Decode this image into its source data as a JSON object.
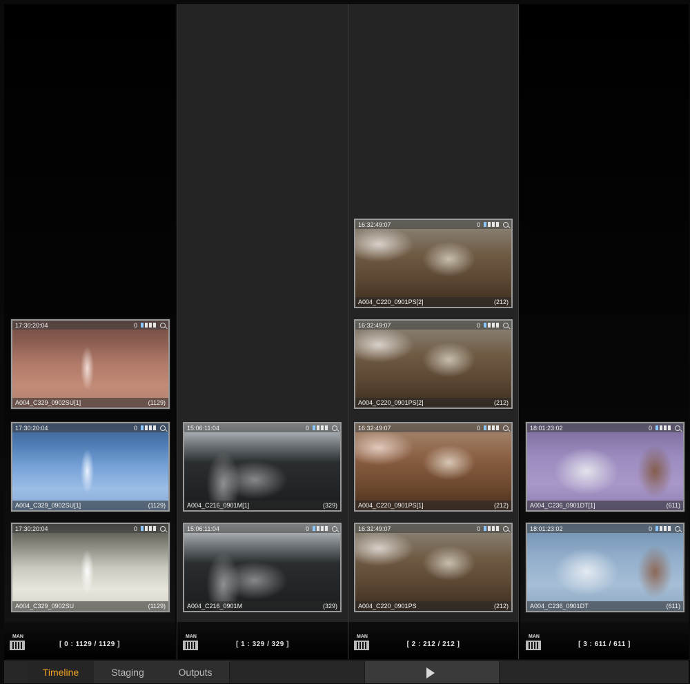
{
  "columns": [
    {
      "clips": [
        {
          "tc": "17:30:20:04",
          "name": "A004_C329_0902SU[1]",
          "frames": "(1129)"
        },
        {
          "tc": "17:30:20:04",
          "name": "A004_C329_0902SU[1]",
          "frames": "(1129)"
        },
        {
          "tc": "17:30:20:04",
          "name": "A004_C329_0902SU",
          "frames": "(1129)"
        }
      ],
      "badge": "MAN",
      "count": "[ 0 : 1129 / 1129 ]"
    },
    {
      "clips": [
        {
          "tc": "15:06:11:04",
          "name": "A004_C216_0901M[1]",
          "frames": "(329)"
        },
        {
          "tc": "15:06:11:04",
          "name": "A004_C216_0901M",
          "frames": "(329)"
        }
      ],
      "badge": "MAN",
      "count": "[ 1 : 329 / 329 ]"
    },
    {
      "clips": [
        {
          "tc": "16:32:49:07",
          "name": "A004_C220_0901PS[2]",
          "frames": "(212)"
        },
        {
          "tc": "16:32:49:07",
          "name": "A004_C220_0901PS[2]",
          "frames": "(212)"
        },
        {
          "tc": "16:32:49:07",
          "name": "A004_C220_0901PS[1]",
          "frames": "(212)"
        },
        {
          "tc": "16:32:49:07",
          "name": "A004_C220_0901PS",
          "frames": "(212)"
        }
      ],
      "badge": "MAN",
      "count": "[ 2 : 212 / 212 ]"
    },
    {
      "clips": [
        {
          "tc": "18:01:23:02",
          "name": "A004_C236_0901DT[1]",
          "frames": "(611)"
        },
        {
          "tc": "18:01:23:02",
          "name": "A004_C236_0901DT",
          "frames": "(611)"
        }
      ],
      "badge": "MAN",
      "count": "[ 3 : 611 / 611 ]"
    }
  ],
  "thumb_indicator": "0",
  "tabs": [
    {
      "label": "Timeline",
      "active": true
    },
    {
      "label": "Staging",
      "active": false
    },
    {
      "label": "Outputs",
      "active": false
    }
  ],
  "icons": {
    "play": "play-icon",
    "zoom": "magnifier-icon",
    "badge": "man-film-icon"
  },
  "colors": {
    "active_tab": "#f0a020"
  }
}
